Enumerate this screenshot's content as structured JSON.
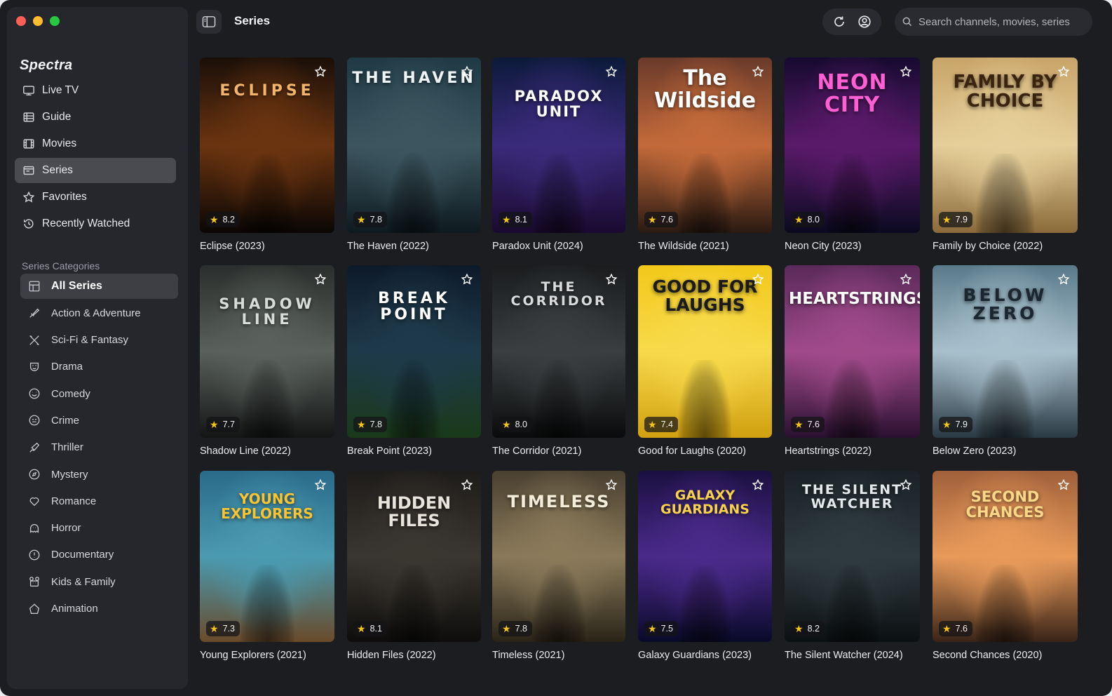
{
  "window": {
    "traffic_lights": [
      "#ff5f57",
      "#febc2e",
      "#28c840"
    ]
  },
  "sidebar": {
    "brand": "Spectra",
    "nav": [
      {
        "label": "Live TV",
        "icon": "tv-icon"
      },
      {
        "label": "Guide",
        "icon": "guide-icon"
      },
      {
        "label": "Movies",
        "icon": "film-icon"
      },
      {
        "label": "Series",
        "icon": "series-icon",
        "active": true
      },
      {
        "label": "Favorites",
        "icon": "star-icon"
      },
      {
        "label": "Recently Watched",
        "icon": "history-icon"
      }
    ],
    "categories_header": "Series Categories",
    "categories": [
      {
        "label": "All Series",
        "icon": "grid-icon",
        "active": true
      },
      {
        "label": "Action & Adventure",
        "icon": "action-icon"
      },
      {
        "label": "Sci-Fi & Fantasy",
        "icon": "scifi-icon"
      },
      {
        "label": "Drama",
        "icon": "drama-icon"
      },
      {
        "label": "Comedy",
        "icon": "comedy-icon"
      },
      {
        "label": "Crime",
        "icon": "crime-icon"
      },
      {
        "label": "Thriller",
        "icon": "thriller-icon"
      },
      {
        "label": "Mystery",
        "icon": "mystery-icon"
      },
      {
        "label": "Romance",
        "icon": "romance-icon"
      },
      {
        "label": "Horror",
        "icon": "horror-icon"
      },
      {
        "label": "Documentary",
        "icon": "documentary-icon"
      },
      {
        "label": "Kids & Family",
        "icon": "kids-icon"
      },
      {
        "label": "Animation",
        "icon": "animation-icon"
      }
    ]
  },
  "header": {
    "title": "Series",
    "search_placeholder": "Search channels, movies, series"
  },
  "series": [
    {
      "poster_text": "ECLIPSE",
      "caption": "Eclipse (2023)",
      "rating": "8.2",
      "bg": [
        "#1a0f08",
        "#6b3410",
        "#0a0604"
      ],
      "text_color": "#f1b46a"
    },
    {
      "poster_text": "THE HAVEN",
      "caption": "The Haven (2022)",
      "rating": "7.8",
      "bg": [
        "#1f3a44",
        "#3c5660",
        "#0e1a20"
      ],
      "text_color": "#eef3f5"
    },
    {
      "poster_text": "PARADOX UNIT",
      "caption": "Paradox Unit (2024)",
      "rating": "8.1",
      "bg": [
        "#0c1a3a",
        "#3a2a7a",
        "#1a0a30"
      ],
      "text_color": "#ffffff"
    },
    {
      "poster_text": "The Wildside",
      "caption": "The Wildside (2021)",
      "rating": "7.6",
      "bg": [
        "#6a3a2a",
        "#c46a3a",
        "#2a1a12"
      ],
      "text_color": "#ffffff"
    },
    {
      "poster_text": "NEON CITY",
      "caption": "Neon City (2023)",
      "rating": "8.0",
      "bg": [
        "#160a30",
        "#5a1a6a",
        "#0a0a20"
      ],
      "text_color": "#ff5fd2"
    },
    {
      "poster_text": "FAMILY BY CHOICE",
      "caption": "Family by Choice (2022)",
      "rating": "7.9",
      "bg": [
        "#c8a468",
        "#e6cf9a",
        "#8a6a3a"
      ],
      "text_color": "#3a2410"
    },
    {
      "poster_text": "SHADOW LINE",
      "caption": "Shadow Line (2022)",
      "rating": "7.7",
      "bg": [
        "#2a2e2c",
        "#5a605c",
        "#141615"
      ],
      "text_color": "#d8dcd8"
    },
    {
      "poster_text": "BREAK POINT",
      "caption": "Break Point (2023)",
      "rating": "7.8",
      "bg": [
        "#0e1a2a",
        "#1e3a4a",
        "#1a3a1a"
      ],
      "text_color": "#ffffff"
    },
    {
      "poster_text": "THE CORRIDOR",
      "caption": "The Corridor (2021)",
      "rating": "8.0",
      "bg": [
        "#1a1c1e",
        "#3a3e40",
        "#0a0b0c"
      ],
      "text_color": "#d8dadc"
    },
    {
      "poster_text": "GOOD FOR LAUGHS",
      "caption": "Good for Laughs (2020)",
      "rating": "7.4",
      "bg": [
        "#f2c81a",
        "#f7d94a",
        "#d0a010"
      ],
      "text_color": "#1a1a1a"
    },
    {
      "poster_text": "HEARTSTRINGS",
      "caption": "Heartstrings (2022)",
      "rating": "7.6",
      "bg": [
        "#5a2a5a",
        "#a04a8a",
        "#2a1030"
      ],
      "text_color": "#ffffff"
    },
    {
      "poster_text": "BELOW ZERO",
      "caption": "Below Zero (2023)",
      "rating": "7.9",
      "bg": [
        "#5a7a8a",
        "#a8c0cc",
        "#2a3a44"
      ],
      "text_color": "#1a2630"
    },
    {
      "poster_text": "YOUNG EXPLORERS",
      "caption": "Young Explorers (2021)",
      "rating": "7.3",
      "bg": [
        "#2a6a8a",
        "#4a9ab0",
        "#6a4a2a"
      ],
      "text_color": "#f7c531"
    },
    {
      "poster_text": "HIDDEN FILES",
      "caption": "Hidden Files (2022)",
      "rating": "8.1",
      "bg": [
        "#1e1c1a",
        "#3a3630",
        "#0e0d0c"
      ],
      "text_color": "#e8e4dc"
    },
    {
      "poster_text": "TIMELESS",
      "caption": "Timeless (2021)",
      "rating": "7.8",
      "bg": [
        "#4a4030",
        "#8a7a5a",
        "#2a2418"
      ],
      "text_color": "#f4ecd8"
    },
    {
      "poster_text": "GALAXY GUARDIANS",
      "caption": "Galaxy Guardians (2023)",
      "rating": "7.5",
      "bg": [
        "#1a1040",
        "#4a2a8a",
        "#0a0a2a"
      ],
      "text_color": "#f7d24a"
    },
    {
      "poster_text": "THE SILENT WATCHER",
      "caption": "The Silent Watcher (2024)",
      "rating": "8.2",
      "bg": [
        "#1a2226",
        "#2e3a3e",
        "#0c1012"
      ],
      "text_color": "#e4eaec"
    },
    {
      "poster_text": "SECOND CHANCES",
      "caption": "Second Chances  (2020)",
      "rating": "7.6",
      "bg": [
        "#a0603a",
        "#e89a5a",
        "#3a2418"
      ],
      "text_color": "#fbd78a"
    }
  ]
}
